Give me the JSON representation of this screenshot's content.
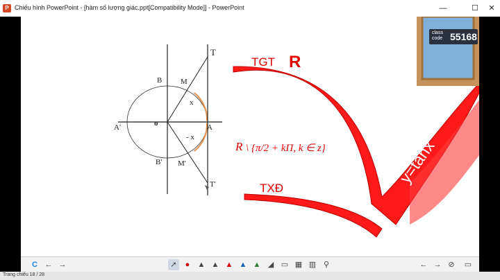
{
  "window": {
    "title": "Chiếu hình PowerPoint - [hàm số lượng giác.ppt[Compatibility Mode]] - PowerPoint",
    "app_icon": "powerpoint-icon",
    "minimize": "—",
    "maximize": "☐",
    "close": "✕"
  },
  "logo": {
    "small_line1": "class",
    "small_line2": "code",
    "number": "55168"
  },
  "slide": {
    "labels": {
      "T": "T",
      "T_prime": "T'",
      "M": "M",
      "M_prime": "M'",
      "B": "B",
      "B_prime": "B'",
      "A": "A",
      "A_prime": "A'",
      "O": "o",
      "x": "x",
      "minus_x": "- x"
    },
    "tgt_label": "TGT",
    "tgt_symbol": "R",
    "domain_R": "R",
    "domain_set": "\\ {π/2 + kΠ, k ∈ z}",
    "txd_label": "TXĐ",
    "func_label": "y=tanx"
  },
  "toolbar": {
    "icons": [
      "clipboard-icon",
      "back-arrow-icon",
      "forward-arrow-icon",
      "pointer-icon",
      "laser-pen-icon",
      "pen-icon",
      "highlighter-icon",
      "pen-red-icon",
      "pen-blue-icon",
      "pen-green-icon",
      "eraser-icon",
      "slide-view-icon",
      "grid-view-icon",
      "chart-view-icon",
      "zoom-icon"
    ],
    "right_icons": [
      "prev-slide-icon",
      "next-slide-icon",
      "hide-icon",
      "monitor-icon"
    ]
  },
  "status": {
    "text": "Trang chiếu 18 / 28"
  }
}
